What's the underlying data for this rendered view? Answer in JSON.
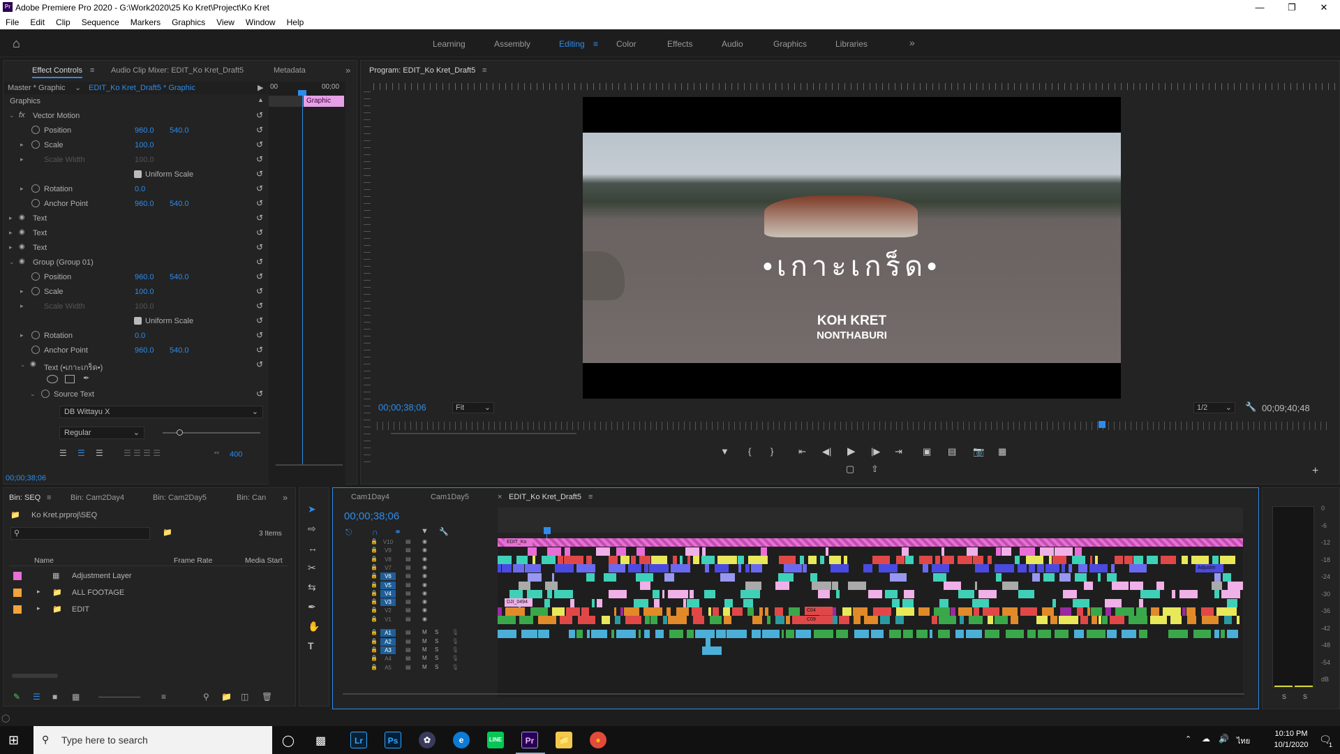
{
  "app": {
    "title": "Adobe Premiere Pro 2020 - G:\\Work2020\\25 Ko Kret\\Project\\Ko Kret",
    "icon": "Pr"
  },
  "menu": [
    "File",
    "Edit",
    "Clip",
    "Sequence",
    "Markers",
    "Graphics",
    "View",
    "Window",
    "Help"
  ],
  "workspaces": [
    "Learning",
    "Assembly",
    "Editing",
    "Color",
    "Effects",
    "Audio",
    "Graphics",
    "Libraries"
  ],
  "effect_controls": {
    "tabs": [
      "Effect Controls",
      "Audio Clip Mixer: EDIT_Ko Kret_Draft5",
      "Metadata"
    ],
    "master": "Master * Graphic",
    "clip": "EDIT_Ko Kret_Draft5 * Graphic",
    "mini_tc_left": "00",
    "mini_tc_right": "00;00",
    "mini_clip": "Graphic",
    "section": "Graphics",
    "vector_motion": "Vector Motion",
    "position": "Position",
    "scale": "Scale",
    "scale_width": "Scale Width",
    "uniform_scale": "Uniform Scale",
    "rotation": "Rotation",
    "anchor_point": "Anchor Point",
    "pos_x": "960.0",
    "pos_y": "540.0",
    "scale_val": "100.0",
    "rot_val": "0.0",
    "text1": "Text",
    "text2": "Text",
    "text3": "Text",
    "group": "Group (Group 01)",
    "text_layer": "Text (•เกาะเกร็ด•)",
    "source_text": "Source Text",
    "font": "DB Wittayu X",
    "style": "Regular",
    "tracking": "400",
    "timecode": "00;00;38;06"
  },
  "program": {
    "title": "Program: EDIT_Ko Kret_Draft5",
    "thai_title": "•เกาะเกร็ด•",
    "title_line1": "KOH KRET",
    "title_line2": "NONTHABURI",
    "timecode": "00;00;38;06",
    "fit": "Fit",
    "resolution": "1/2",
    "duration": "00;09;40;48"
  },
  "project": {
    "tabs": [
      "Bin: SEQ",
      "Bin: Cam2Day4",
      "Bin: Cam2Day5",
      "Bin: Can"
    ],
    "path": "Ko Kret.prproj\\SEQ",
    "items_count": "3 Items",
    "cols": [
      "Name",
      "Frame Rate",
      "Media Start"
    ],
    "items": [
      {
        "name": "Adjustment Layer",
        "color": "#e86fd5"
      },
      {
        "name": "ALL FOOTAGE",
        "color": "#f2a33a"
      },
      {
        "name": "EDIT",
        "color": "#f2a33a"
      }
    ]
  },
  "timeline": {
    "tabs": [
      "Cam1Day4",
      "Cam1Day5",
      "EDIT_Ko Kret_Draft5"
    ],
    "timecode": "00;00;38;06",
    "video_tracks": [
      "V10",
      "V9",
      "V8",
      "V7",
      "V6",
      "V5",
      "V4",
      "V3",
      "V2",
      "V1"
    ],
    "audio_tracks": [
      "A1",
      "A2",
      "A3",
      "A4",
      "A5"
    ],
    "clip_labels": [
      "EDIT_Ko",
      "DJI_0494",
      "Adjustm",
      "C04",
      "C09"
    ]
  },
  "meters": {
    "scale": [
      "0",
      "-6",
      "-12",
      "-18",
      "-24",
      "-30",
      "-36",
      "-42",
      "-48",
      "-54",
      "dB"
    ],
    "solo": [
      "S",
      "S"
    ]
  },
  "taskbar": {
    "search": "Type here to search",
    "time": "10:10 PM",
    "date": "10/1/2020",
    "lang": "ไทย",
    "notif": "1"
  }
}
